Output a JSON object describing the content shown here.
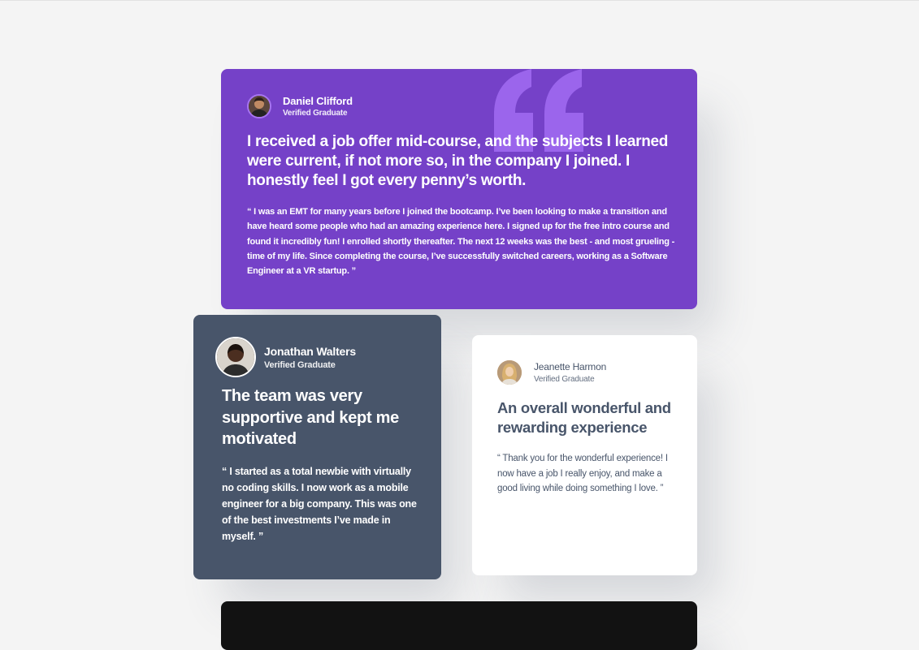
{
  "colors": {
    "page_bg": "#f4f4f4",
    "purple": "#7541c8",
    "purple_quote": "#9b65ec",
    "grayish_blue": "#48556a",
    "white": "#ffffff",
    "dark": "#121212"
  },
  "testimonials": [
    {
      "name": "Daniel Clifford",
      "role": "Verified Graduate",
      "avatar_icon": "avatar-photo",
      "headline": "I received a job offer mid-course, and the subjects I learned were current, if not more so, in the company I joined. I honestly feel I got every penny’s worth.",
      "quote": "“ I was an EMT for many years before I joined the bootcamp. I’ve been looking to make a transition and have heard some people who had an amazing experience here. I signed up for the free intro course and found it incredibly fun! I enrolled shortly thereafter. The next 12 weeks was the best - and most grueling - time of my life. Since completing the course, I’ve successfully switched careers, working as a Software Engineer at a VR startup. ”"
    },
    {
      "name": "Jonathan Walters",
      "role": "Verified Graduate",
      "avatar_icon": "avatar-photo",
      "headline": "The team was very supportive and kept me motivated",
      "quote": "“ I started as a total newbie with virtually no coding skills. I now work as a mobile engineer for a big company. This was one of the best investments I’ve made in myself. ”"
    },
    {
      "name": "Jeanette Harmon",
      "role": "Verified Graduate",
      "avatar_icon": "avatar-photo",
      "headline": "An overall wonderful and rewarding experience",
      "quote": "“ Thank you for the wonderful experience! I now have a job I really enjoy, and make a good living while doing something I love. ”"
    }
  ],
  "decor": {
    "quote_icon": "quotation-mark-icon"
  }
}
